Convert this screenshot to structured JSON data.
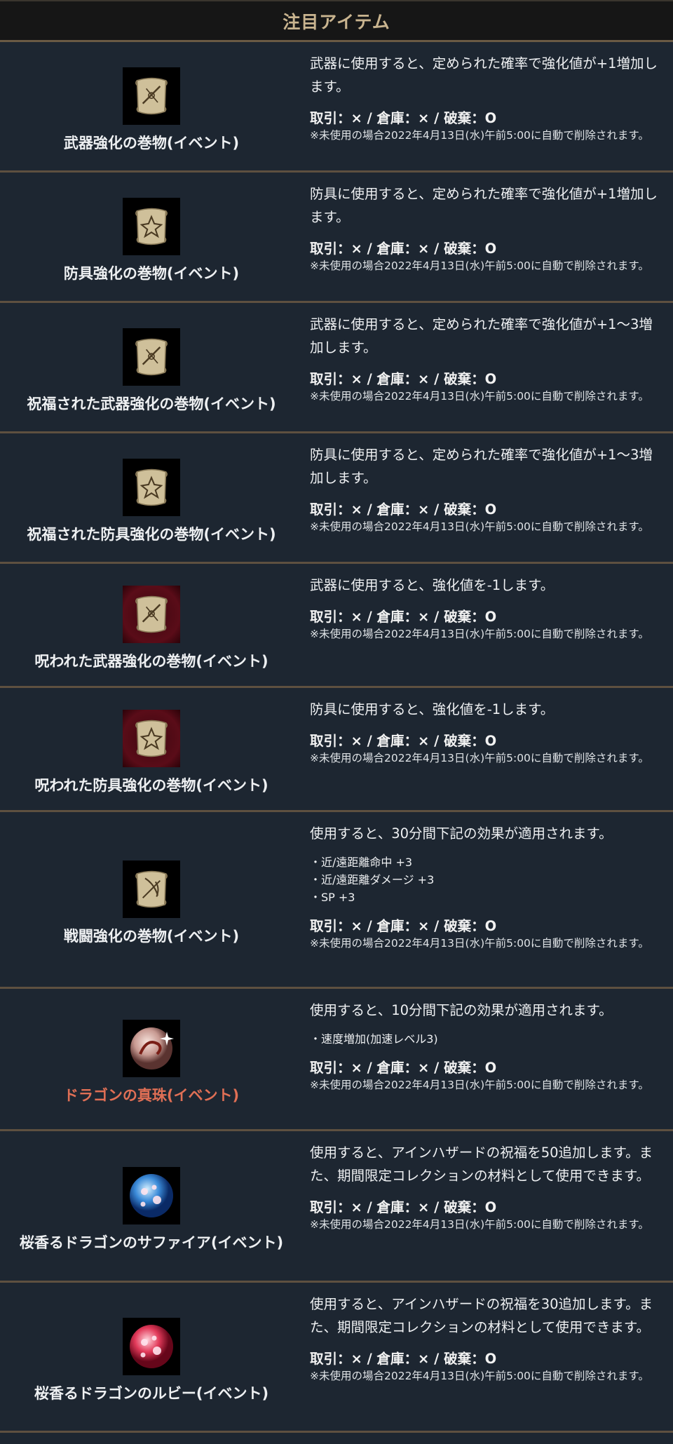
{
  "header": {
    "title": "注目アイテム"
  },
  "trade_label": "取引：× / 倉庫：× / 破棄：O",
  "note_label": "※未使用の場合2022年4月13日(水)午前5:00に自動で削除されます。",
  "items": [
    {
      "name": "武器強化の巻物(イベント)",
      "icon": "weapon-scroll-icon",
      "desc": "武器に使用すると、定められた確率で強化値が+1増加します。",
      "effects": []
    },
    {
      "name": "防具強化の巻物(イベント)",
      "icon": "armor-scroll-icon",
      "desc": "防具に使用すると、定められた確率で強化値が+1増加します。",
      "effects": []
    },
    {
      "name": "祝福された武器強化の巻物(イベント)",
      "icon": "blessed-weapon-scroll-icon",
      "desc": "武器に使用すると、定められた確率で強化値が+1～3増加します。",
      "effects": []
    },
    {
      "name": "祝福された防具強化の巻物(イベント)",
      "icon": "blessed-armor-scroll-icon",
      "desc": "防具に使用すると、定められた確率で強化値が+1～3増加します。",
      "effects": []
    },
    {
      "name": "呪われた武器強化の巻物(イベント)",
      "icon": "cursed-weapon-scroll-icon",
      "desc": "武器に使用すると、強化値を-1します。",
      "effects": []
    },
    {
      "name": "呪われた防具強化の巻物(イベント)",
      "icon": "cursed-armor-scroll-icon",
      "desc": "防具に使用すると、強化値を-1します。",
      "effects": []
    },
    {
      "name": "戦闘強化の巻物(イベント)",
      "icon": "battle-scroll-icon",
      "desc": "使用すると、30分間下記の効果が適用されます。",
      "effects": [
        "・近/遠距離命中 +3",
        "・近/遠距離ダメージ +3",
        "・SP +3"
      ]
    },
    {
      "name": "ドラゴンの真珠(イベント)",
      "icon": "dragon-pearl-icon",
      "desc": "使用すると、10分間下記の効果が適用されます。",
      "effects": [
        "・速度増加(加速レベル3)"
      ]
    },
    {
      "name": "桜香るドラゴンのサファイア(イベント)",
      "icon": "sakura-sapphire-icon",
      "desc": "使用すると、アインハザードの祝福を50追加します。また、期間限定コレクションの材料として使用できます。",
      "effects": []
    },
    {
      "name": "桜香るドラゴンのルビー(イベント)",
      "icon": "sakura-ruby-icon",
      "desc": "使用すると、アインハザードの祝福を30追加します。また、期間限定コレクションの材料として使用できます。",
      "effects": []
    }
  ]
}
